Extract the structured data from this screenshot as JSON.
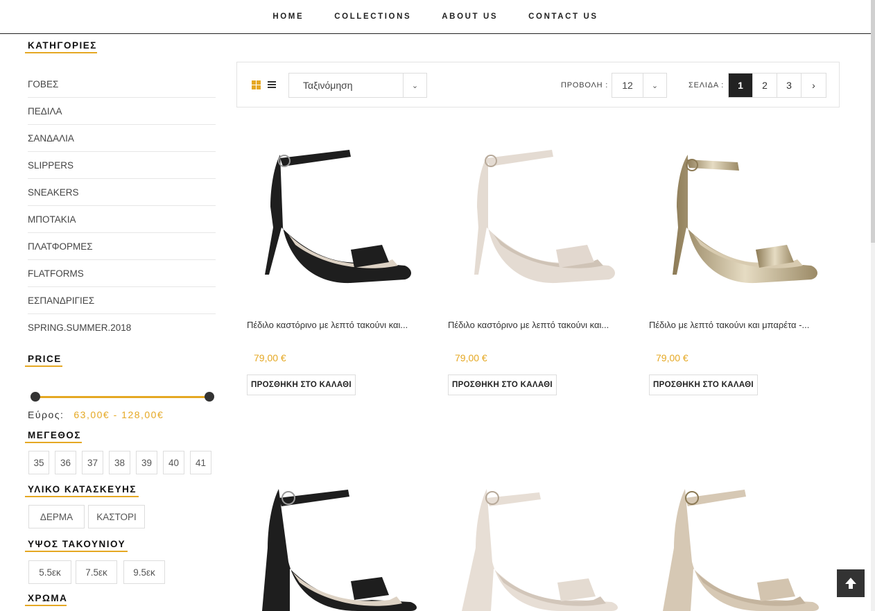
{
  "nav": {
    "items": [
      "HOME",
      "COLLECTIONS",
      "ABOUT US",
      "CONTACT US"
    ]
  },
  "sidebar": {
    "categories_title": "ΚΑΤΗΓΟΡΙΕΣ",
    "categories": [
      "ΓΟΒΕΣ",
      "ΠΕΔΙΛΑ",
      "ΣΑΝΔΑΛΙΑ",
      "SLIPPERS",
      "SNEAKERS",
      "ΜΠΟΤΑΚΙΑ",
      "ΠΛΑΤΦΟΡΜΕΣ",
      "FLATFORMS",
      "ΕΣΠΑΝΔΡΙΓΙΕΣ",
      "SPRING.SUMMER.2018"
    ],
    "price_title": "PRICE",
    "price_range_label": "Εύρος:",
    "price_range_value": "63,00€ - 128,00€",
    "price_min": 63,
    "price_max": 128,
    "size_title": "ΜΕΓΕΘΟΣ",
    "sizes": [
      "35",
      "36",
      "37",
      "38",
      "39",
      "40",
      "41"
    ],
    "material_title": "ΥΛΙΚΟ ΚΑΤΑΣΚΕΥΗΣ",
    "materials": [
      "ΔΕΡΜΑ",
      "ΚΑΣΤΟΡΙ"
    ],
    "heel_title": "ΥΨΟΣ ΤΑΚΟΥΝΙΟΥ",
    "heels": [
      "5.5εκ",
      "7.5εκ",
      "9.5εκ"
    ],
    "color_title": "ΧΡΩΜΑ"
  },
  "toolbar": {
    "sort_label": "Ταξινόμηση",
    "show_label": "ΠΡΟΒΟΛΗ :",
    "show_value": "12",
    "page_label": "ΣΕΛΙΔΑ :",
    "pages": [
      "1",
      "2",
      "3",
      "›"
    ],
    "active_page": "1"
  },
  "products": [
    {
      "name": "Πέδιλο καστόρινο με λεπτό τακούνι και...",
      "price": "79,00 €",
      "button": "ΠΡΟΣΘΗΚΗ ΣΤΟ ΚΑΛΑΘΙ",
      "color": "#1e1e1e",
      "heel": "thin"
    },
    {
      "name": "Πέδιλο καστόρινο με λεπτό τακούνι και...",
      "price": "79,00 €",
      "button": "ΠΡΟΣΘΗΚΗ ΣΤΟ ΚΑΛΑΘΙ",
      "color": "#e4dbd2",
      "heel": "thin"
    },
    {
      "name": "Πέδιλο με λεπτό τακούνι και μπαρέτα -...",
      "price": "79,00 €",
      "button": "ΠΡΟΣΘΗΚΗ ΣΤΟ ΚΑΛΑΘΙ",
      "color": "#c9bda1",
      "heel": "thin"
    },
    {
      "name": "",
      "price": "",
      "button": "",
      "color": "#1e1e1e",
      "heel": "block"
    },
    {
      "name": "",
      "price": "",
      "button": "",
      "color": "#e7ded5",
      "heel": "block"
    },
    {
      "name": "",
      "price": "",
      "button": "",
      "color": "#d6c8b4",
      "heel": "block"
    }
  ],
  "colors": {
    "accent": "#e5a823",
    "dark": "#222222",
    "border": "#dddddd"
  },
  "icons": {
    "grid_view": "grid-view-icon",
    "list_view": "list-view-icon",
    "back_to_top": "arrow-up-icon"
  }
}
